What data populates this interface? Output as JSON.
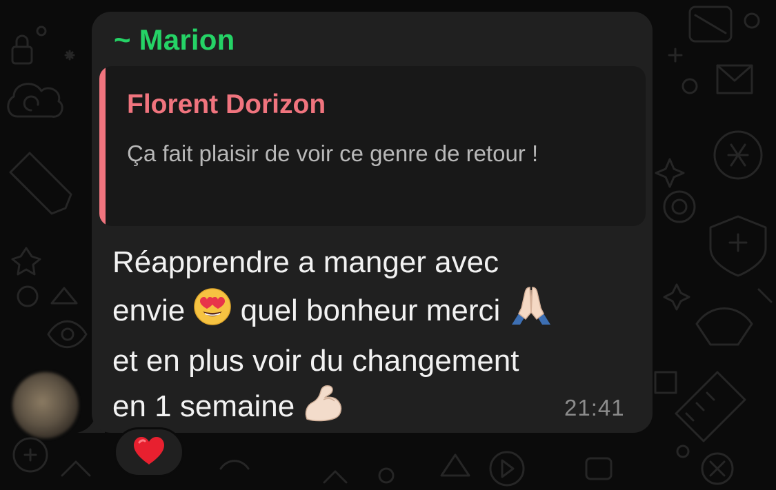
{
  "theme": {
    "background": "#0b0b0b",
    "bubble": "#202020",
    "quote_background": "#181818",
    "sender_color": "#25d366",
    "quote_accent": "#f0747e",
    "text_color": "#f2f2f2",
    "meta_color": "#8c8c8c"
  },
  "message": {
    "sender": "~ Marion",
    "quoted": {
      "author": "Florent Dorizon",
      "text": "Ça fait plaisir de voir ce genre de retour !"
    },
    "lines": [
      {
        "text": "Réapprendre a manger avec"
      },
      {
        "before": "envie ",
        "emoji": "heart-eyes-emoji",
        "after": " quel bonheur merci ",
        "emoji2": "folded-hands-emoji"
      },
      {
        "text": "et en plus voir du changement"
      },
      {
        "before": "en 1 semaine ",
        "emoji": "flexed-biceps-emoji"
      }
    ],
    "time": "21:41",
    "reaction": {
      "emoji": "red-heart-emoji"
    }
  }
}
